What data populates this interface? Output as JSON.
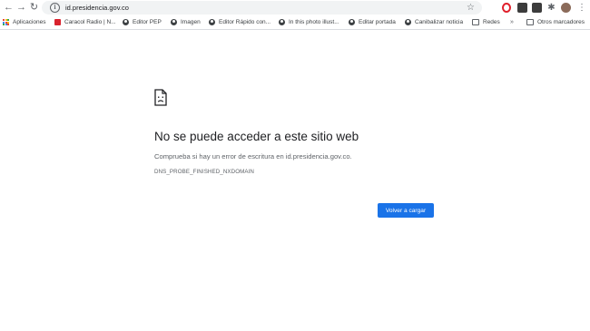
{
  "toolbar": {
    "back_icon": "back-arrow-icon",
    "forward_icon": "forward-arrow-icon",
    "reload_icon": "reload-icon",
    "url": "id.presidencia.gov.co"
  },
  "bookmarks": {
    "items": [
      {
        "label": "Aplicaciones",
        "icon": "apps-icon"
      },
      {
        "label": "Caracol Radio | N...",
        "icon": "caracol-favicon"
      },
      {
        "label": "Editor PEP",
        "icon": "globe-icon"
      },
      {
        "label": "Imagen",
        "icon": "globe-icon"
      },
      {
        "label": "Editor Rápido con...",
        "icon": "globe-icon"
      },
      {
        "label": "In this photo illust...",
        "icon": "globe-icon"
      },
      {
        "label": "Editar portada",
        "icon": "globe-icon"
      },
      {
        "label": "Canibalizar noticia",
        "icon": "globe-icon"
      },
      {
        "label": "Redes",
        "icon": "folder-icon"
      }
    ],
    "overflow": "»",
    "other_label": "Otros marcadores"
  },
  "error": {
    "heading": "No se puede acceder a este sitio web",
    "suggestion": "Comprueba si hay un error de escritura en id.presidencia.gov.co.",
    "code": "DNS_PROBE_FINISHED_NXDOMAIN",
    "button_label": "Volver a cargar"
  },
  "colors": {
    "accent": "#1a73e8",
    "text": "#202124",
    "secondary_text": "#5f6368"
  }
}
